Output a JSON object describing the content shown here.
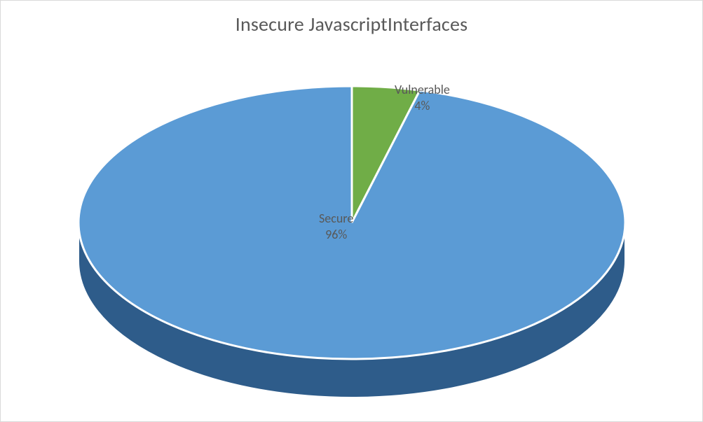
{
  "chart_data": {
    "type": "pie",
    "title": "Insecure JavascriptInterfaces",
    "series": [
      {
        "name": "Vulnerable",
        "value": 4,
        "label": "Vulnerable",
        "pct": "4%",
        "color": "#70ad47",
        "side": "#548236"
      },
      {
        "name": "Secure",
        "value": 96,
        "label": "Secure",
        "pct": "96%",
        "color": "#5b9bd5",
        "side": "#2e5c8a"
      }
    ]
  }
}
